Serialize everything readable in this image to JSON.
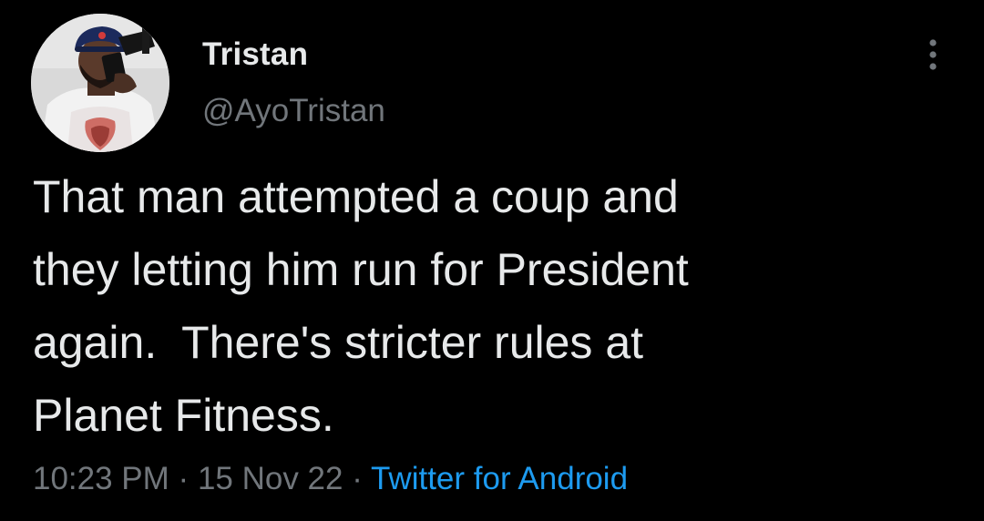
{
  "author": {
    "display_name": "Tristan",
    "handle": "@AyoTristan",
    "avatar_icon": "profile-photo"
  },
  "tweet": {
    "text": "That man attempted a coup and\nthey letting him run for President\nagain.  There's stricter rules at\nPlanet Fitness.",
    "time": "10:23 PM",
    "separator": "·",
    "date": "15 Nov 22",
    "source": "Twitter for Android"
  },
  "menu": {
    "icon": "more-vertical-icon"
  },
  "colors": {
    "background": "#000000",
    "text_primary": "#e7e9ea",
    "text_secondary": "#71767b",
    "link": "#1d9bf0"
  }
}
